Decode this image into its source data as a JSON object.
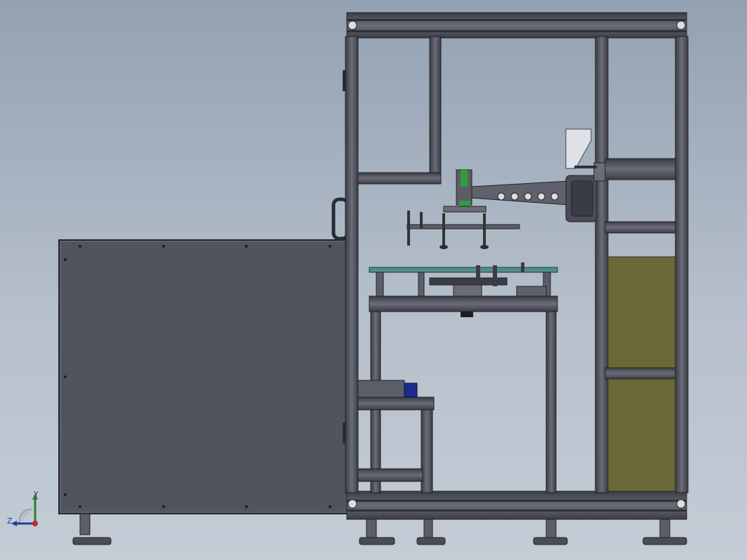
{
  "viewport": {
    "background_top": "#93a1b2",
    "background_bottom": "#c4ccd6"
  },
  "model_colors": {
    "frame": "#4a4c57",
    "frame_dark": "#2e3038",
    "panel": "#51535f",
    "olive_panel": "#6b6838",
    "glass": "#4f8f8c",
    "green_part": "#2e9e3a",
    "blue_part": "#1d2a8a"
  },
  "triad": {
    "x_axis_color": "#c62828",
    "y_axis_color": "#2e7d32",
    "z_axis_color": "#1e3fa8",
    "y_label": "Y",
    "z_label": "Z"
  }
}
